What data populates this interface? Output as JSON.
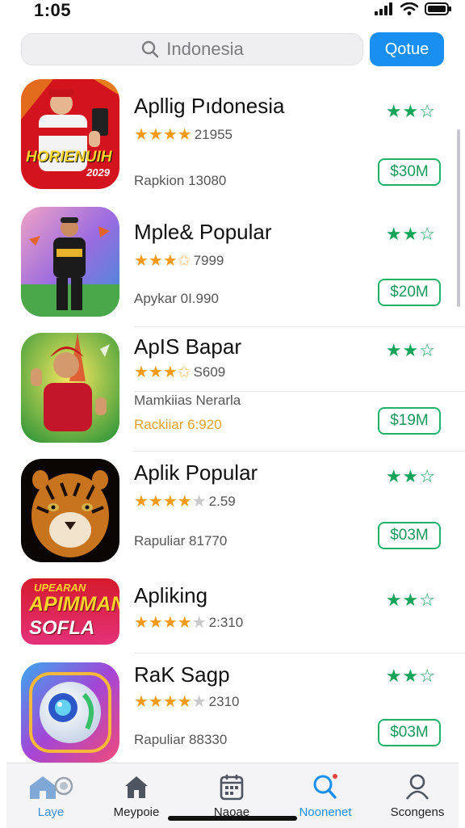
{
  "status_bar": {
    "time": "1:05"
  },
  "search": {
    "query": "Indonesia",
    "button_label": "Qotue"
  },
  "apps": [
    {
      "name": "Apllig Pıdonesia",
      "rating_count": "21955",
      "stars": 4,
      "line1": "Rapkion 13080",
      "line2": "",
      "price": "$30M",
      "icon_name": "athlete-with-phone-icon",
      "icon_text": "HORIENUIH",
      "icon_subtext": "2029"
    },
    {
      "name": "Mple& Popular",
      "rating_count": "7999",
      "stars": 3.5,
      "line1": "Apykar 0I.990",
      "line2": "",
      "price": "$20M",
      "icon_name": "dancer-icon",
      "icon_text": "",
      "icon_subtext": ""
    },
    {
      "name": "ApIS Bapar",
      "rating_count": "S609",
      "stars": 3.5,
      "line1": "Mamkiias Nerarla",
      "line2": "Rackiiar 6:920",
      "price": "$19M",
      "icon_name": "thumbs-up-person-icon",
      "icon_text": "",
      "icon_subtext": ""
    },
    {
      "name": "Aplik Popular",
      "rating_count": "2.59",
      "stars": 4,
      "line1": "Rapuliar 81770",
      "line2": "",
      "price": "$03M",
      "icon_name": "tiger-icon",
      "icon_text": "",
      "icon_subtext": ""
    },
    {
      "name": "Apliking",
      "rating_count": "2:310",
      "stars": 4,
      "line1": "",
      "line2": "",
      "price": "",
      "icon_name": "text-logo-icon",
      "icon_text": "APIMMAN",
      "icon_top_text": "UPEARAN",
      "icon_subtext": "SOFLA"
    },
    {
      "name": "RaK Sagp",
      "rating_count": "2310",
      "stars": 4,
      "line1": "Rapuliar 88330",
      "line2": "",
      "price": "$03M",
      "icon_name": "camera-ball-icon",
      "icon_text": "",
      "icon_subtext": ""
    }
  ],
  "tabs": [
    {
      "label": "Laye",
      "icon": "home-icon",
      "active": false
    },
    {
      "label": "Meypoie",
      "icon": "house-icon",
      "active": false
    },
    {
      "label": "Naoae",
      "icon": "calendar-icon",
      "active": false
    },
    {
      "label": "Noonenet",
      "icon": "search-icon",
      "active": true
    },
    {
      "label": "Scongens",
      "icon": "person-icon",
      "active": false
    }
  ],
  "colors": {
    "accent_blue": "#1a8ff2",
    "star_orange": "#f59a17",
    "rating_green": "#17a35a",
    "price_border": "#21b26a"
  }
}
